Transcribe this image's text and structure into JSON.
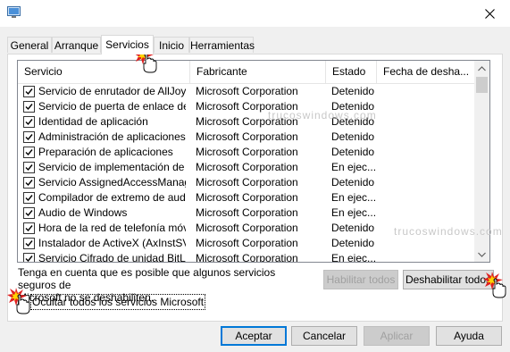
{
  "tabs": [
    "General",
    "Arranque",
    "Servicios",
    "Inicio",
    "Herramientas"
  ],
  "active_tab": "Servicios",
  "columns": [
    "Servicio",
    "Fabricante",
    "Estado",
    "Fecha de desha..."
  ],
  "rows": [
    {
      "servicio": "Servicio de enrutador de AllJoyn",
      "fabricante": "Microsoft Corporation",
      "estado": "Detenido",
      "checked": true
    },
    {
      "servicio": "Servicio de puerta de enlace de ...",
      "fabricante": "Microsoft Corporation",
      "estado": "Detenido",
      "checked": true
    },
    {
      "servicio": "Identidad de aplicación",
      "fabricante": "Microsoft Corporation",
      "estado": "Detenido",
      "checked": true
    },
    {
      "servicio": "Administración de aplicaciones",
      "fabricante": "Microsoft Corporation",
      "estado": "Detenido",
      "checked": true
    },
    {
      "servicio": "Preparación de aplicaciones",
      "fabricante": "Microsoft Corporation",
      "estado": "Detenido",
      "checked": true
    },
    {
      "servicio": "Servicio de implementación de A...",
      "fabricante": "Microsoft Corporation",
      "estado": "En ejec...",
      "checked": true
    },
    {
      "servicio": "Servicio AssignedAccessManager",
      "fabricante": "Microsoft Corporation",
      "estado": "Detenido",
      "checked": true
    },
    {
      "servicio": "Compilador de extremo de audio...",
      "fabricante": "Microsoft Corporation",
      "estado": "En ejec...",
      "checked": true
    },
    {
      "servicio": "Audio de Windows",
      "fabricante": "Microsoft Corporation",
      "estado": "En ejec...",
      "checked": true
    },
    {
      "servicio": "Hora de la red de telefonía móvil",
      "fabricante": "Microsoft Corporation",
      "estado": "Detenido",
      "checked": true
    },
    {
      "servicio": "Instalador de ActiveX (AxInstSV)",
      "fabricante": "Microsoft Corporation",
      "estado": "Detenido",
      "checked": true
    },
    {
      "servicio": "Servicio Cifrado de unidad BitLoc...",
      "fabricante": "Microsoft Corporation",
      "estado": "En ejec...",
      "checked": true
    }
  ],
  "info_text_1": "Tenga en cuenta que es posible que algunos servicios seguros de",
  "info_text_2": "Microsoft no se deshabiliten.",
  "enable_all": "Habilitar todos",
  "disable_all": "Deshabilitar todos",
  "hide_ms_label": "Ocultar todos los servicios Microsoft",
  "hide_ms_checked": false,
  "buttons": {
    "accept": "Aceptar",
    "cancel": "Cancelar",
    "apply": "Aplicar",
    "help": "Ayuda"
  },
  "watermark": "trucoswindows.com",
  "icons": {
    "app": "msconfig-icon",
    "close": "close-icon",
    "check": "check-icon",
    "cursor": "hand-cursor-icon"
  }
}
